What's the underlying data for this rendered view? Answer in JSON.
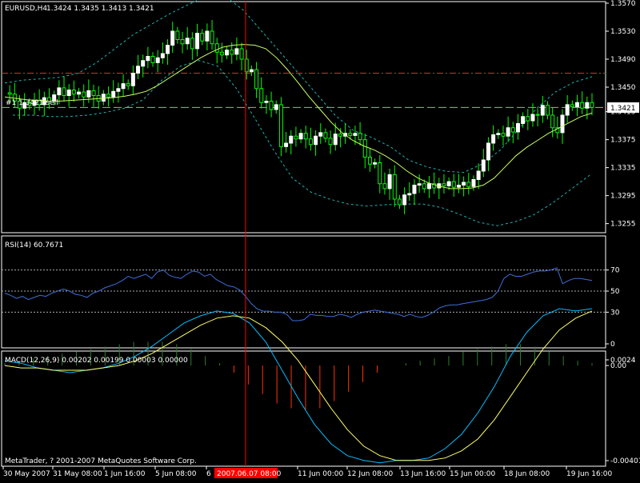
{
  "colors": {
    "background": "#000000",
    "frame": "#ffffff",
    "bull_candle": "#ffffff",
    "bear_candle": "#000000",
    "candle_wick": "#00ff00",
    "ma": "#ccff66",
    "bands": "#20b2aa",
    "resistance_line": "#cc3333",
    "bid_line": "#8fbc8f",
    "rsi": "#3d6fd9",
    "rsi_levels": "#aaaaaa",
    "macd_main": "#00bfff",
    "macd_signal": "#ffff66",
    "hist_pos": "#2e7d2e",
    "hist_neg": "#ff3300",
    "crosshair": "#ff0000"
  },
  "header": {
    "symbol": "EURUSD,H4",
    "ohlc": "1.3424 1.3435 1.3413 1.3421"
  },
  "order_label": "#1 1.3421 sell",
  "price_tag": "1.3421",
  "crosshair_label": "2007.06.07 08:00",
  "copyright": "MetaTrader, ? 2001-2007 MetaQuotes Software Corp.",
  "rsi_header": "RSI(14) 60.7671",
  "macd_header": "MACD(12,26,9) 0.00202 0.00199 0.00003 0.00000",
  "chart_data": [
    {
      "type": "candlestick",
      "title": "EURUSD,H4",
      "ylim": [
        1.325,
        1.357
      ],
      "y_ticks": [
        "1.3570",
        "1.3530",
        "1.3490",
        "1.3450",
        "1.3415",
        "1.3375",
        "1.3335",
        "1.3295",
        "1.3255"
      ],
      "x_ticks": [
        "30 May 2007",
        "31 May 08:00",
        "1 Jun 16:00",
        "5 Jun 08:00",
        "6",
        "11 Jun 00:00",
        "12 Jun 08:00",
        "13 Jun 16:00",
        "15 Jun 00:00",
        "18 Jun 08:00",
        "19 Jun 16:00"
      ],
      "horizontal_lines": [
        1.347,
        1.3421
      ],
      "price_path": [
        1.3442,
        1.344,
        1.343,
        1.342,
        1.3428,
        1.3424,
        1.3431,
        1.3425,
        1.3435,
        1.343,
        1.3439,
        1.3449,
        1.3438,
        1.3446,
        1.344,
        1.3443,
        1.3436,
        1.3445,
        1.3438,
        1.343,
        1.344,
        1.3436,
        1.3444,
        1.3448,
        1.3455,
        1.3452,
        1.347,
        1.348,
        1.3488,
        1.3494,
        1.3485,
        1.3492,
        1.3498,
        1.351,
        1.353,
        1.3518,
        1.3512,
        1.352,
        1.3505,
        1.3527,
        1.3516,
        1.353,
        1.3512,
        1.35,
        1.3496,
        1.3503,
        1.3497,
        1.3505,
        1.349,
        1.3472,
        1.3475,
        1.3448,
        1.3428,
        1.343,
        1.3418,
        1.3425,
        1.3365,
        1.337,
        1.338,
        1.3376,
        1.3384,
        1.3376,
        1.3368,
        1.338,
        1.3385,
        1.3377,
        1.3368,
        1.3383,
        1.338,
        1.3384,
        1.3381,
        1.3384,
        1.3375,
        1.335,
        1.334,
        1.3342,
        1.3312,
        1.3305,
        1.3325,
        1.329,
        1.3282,
        1.3296,
        1.3298,
        1.331,
        1.3312,
        1.3305,
        1.3312,
        1.3306,
        1.3312,
        1.3309,
        1.3315,
        1.3307,
        1.331,
        1.3314,
        1.3308,
        1.3318,
        1.333,
        1.3346,
        1.337,
        1.3382,
        1.3384,
        1.338,
        1.3392,
        1.3386,
        1.3398,
        1.3408,
        1.3402,
        1.3411,
        1.341,
        1.3424,
        1.341,
        1.3392,
        1.3385,
        1.341,
        1.3425,
        1.3422,
        1.3428,
        1.342,
        1.3428,
        1.3421
      ],
      "ma": [
        1.3436,
        1.3434,
        1.3432,
        1.3431,
        1.343,
        1.343,
        1.3431,
        1.3432,
        1.3433,
        1.3434,
        1.3435,
        1.3437,
        1.344,
        1.3444,
        1.3452,
        1.3462,
        1.3472,
        1.3482,
        1.3492,
        1.35,
        1.3507,
        1.351,
        1.3511,
        1.351,
        1.3505,
        1.3492,
        1.3475,
        1.3456,
        1.3436,
        1.3418,
        1.34,
        1.3385,
        1.3374,
        1.3366,
        1.336,
        1.3352,
        1.3342,
        1.333,
        1.332,
        1.3313,
        1.3308,
        1.3305,
        1.3305,
        1.3306,
        1.331,
        1.332,
        1.3336,
        1.3352,
        1.3364,
        1.3374,
        1.3384,
        1.3392,
        1.34,
        1.3408,
        1.3413
      ],
      "upper_band": [
        1.3456,
        1.346,
        1.3462,
        1.3464,
        1.347,
        1.3485,
        1.3505,
        1.3525,
        1.354,
        1.3555,
        1.3568,
        1.358,
        1.358,
        1.356,
        1.353,
        1.35,
        1.347,
        1.344,
        1.341,
        1.3388,
        1.3378,
        1.3365,
        1.3346,
        1.3336,
        1.333,
        1.3328,
        1.334,
        1.336,
        1.339,
        1.342,
        1.3443,
        1.3457,
        1.3465
      ],
      "lower_band": [
        1.341,
        1.341,
        1.3408,
        1.3408,
        1.341,
        1.3414,
        1.342,
        1.3432,
        1.346,
        1.348,
        1.3488,
        1.348,
        1.3448,
        1.3405,
        1.336,
        1.332,
        1.33,
        1.329,
        1.3283,
        1.328,
        1.3282,
        1.3283,
        1.3283,
        1.3278,
        1.3268,
        1.3257,
        1.3252,
        1.3258,
        1.3268,
        1.3285,
        1.3305,
        1.3325
      ]
    },
    {
      "type": "line",
      "title": "RSI(14) 60.7671",
      "ylim": [
        0,
        100
      ],
      "y_ticks": [
        70,
        50,
        30,
        0
      ],
      "levels": [
        70,
        50,
        30
      ],
      "series": [
        {
          "values": [
            48,
            46,
            43,
            45,
            42,
            44,
            46,
            45,
            48,
            50,
            52,
            50,
            47,
            46,
            44,
            48,
            50,
            53,
            55,
            57,
            60,
            64,
            62,
            64,
            66,
            62,
            68,
            70,
            65,
            63,
            62,
            66,
            69,
            68,
            64,
            66,
            61,
            58,
            55,
            54,
            51,
            45,
            38,
            33,
            31,
            31,
            30,
            30,
            28,
            22,
            22,
            23,
            28,
            27,
            27,
            26,
            26,
            28,
            27,
            25,
            28,
            30,
            31,
            32,
            31,
            30,
            29,
            28,
            26,
            28,
            26,
            25,
            27,
            30,
            34,
            36,
            37,
            37,
            38,
            39,
            40,
            41,
            42,
            44,
            50,
            62,
            66,
            64,
            64,
            66,
            68,
            69,
            69,
            70,
            72,
            57,
            60,
            62,
            62,
            61,
            60
          ]
        }
      ]
    },
    {
      "type": "bar",
      "title": "MACD(12,26,9) 0.00202 0.00199 0.00003 0.00000",
      "ylim": [
        -0.00401,
        0.00024
      ],
      "y_ticks": [
        "0.0024",
        "0.00",
        "-0.00401"
      ],
      "series": [
        {
          "name": "main",
          "values": [
            0.0002,
            0.0001,
            -0.0001,
            -0.0002,
            -0.0003,
            -0.0002,
            -0.0001,
            0.0001,
            0.0004,
            0.0008,
            0.0013,
            0.0018,
            0.0021,
            0.0023,
            0.0022,
            0.0018,
            0.001,
            -0.0002,
            -0.0014,
            -0.0025,
            -0.0033,
            -0.0038,
            -0.004,
            -0.0041,
            -0.004,
            -0.004,
            -0.0039,
            -0.0035,
            -0.0029,
            -0.002,
            -0.0009,
            0.0004,
            0.0014,
            0.0021,
            0.0024,
            0.0023,
            0.0024
          ]
        },
        {
          "name": "signal",
          "values": [
            0.0,
            -0.0001,
            -0.0001,
            -0.0002,
            -0.0002,
            -0.0002,
            -0.0001,
            0.0,
            0.0002,
            0.0005,
            0.0009,
            0.0013,
            0.0017,
            0.002,
            0.0021,
            0.002,
            0.0016,
            0.001,
            0.0002,
            -0.0008,
            -0.0018,
            -0.0027,
            -0.0034,
            -0.0038,
            -0.004,
            -0.004,
            -0.004,
            -0.0039,
            -0.0036,
            -0.0031,
            -0.0023,
            -0.0013,
            -0.0003,
            0.0007,
            0.0015,
            0.002,
            0.0023
          ]
        },
        {
          "name": "histogram",
          "values": [
            0.0001,
            0.0002,
            0.0003,
            0.0004,
            0.0005,
            0.0006,
            0.0007,
            0.0008,
            0.0009,
            0.001,
            0.001,
            0.001,
            0.0009,
            0.0007,
            0.0004,
            0.0001,
            -0.0003,
            -0.0008,
            -0.0012,
            -0.0016,
            -0.0018,
            -0.0019,
            -0.0018,
            -0.0015,
            -0.0011,
            -0.0007,
            -0.0003,
            0.0,
            0.0001,
            0.0002,
            0.0003,
            0.0004,
            0.0006,
            0.0007,
            0.0008,
            0.0009,
            0.0009,
            0.0008,
            0.0006,
            0.0004,
            0.0002,
            0.0001
          ]
        }
      ]
    }
  ]
}
